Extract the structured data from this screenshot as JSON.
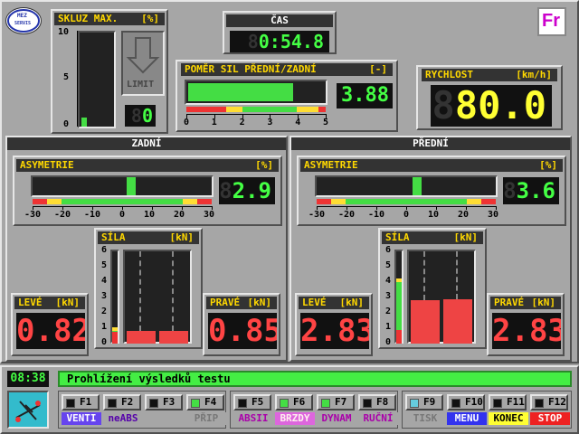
{
  "logo": {
    "top": "MEZ",
    "bottom": "SERVIS"
  },
  "fr_logo": "Fr",
  "skluz": {
    "title": "SKLUZ MAX.",
    "unit": "[%]",
    "ticks": [
      "10",
      "5",
      "0"
    ],
    "value_level": 1.0,
    "limit_label": "LIMIT",
    "digits": "8",
    "value": "0"
  },
  "cas": {
    "title": "ČAS",
    "ghost": "8",
    "value": "0:54.8"
  },
  "pomer": {
    "title": "POMĚR SIL PŘEDNÍ/ZADNÍ",
    "unit": "[-]",
    "ticks": [
      "0",
      "1",
      "2",
      "3",
      "4",
      "5"
    ],
    "ghost": "",
    "value": "3.88",
    "fill_fraction": 0.776
  },
  "rychlost": {
    "title": "RYCHLOST",
    "unit": "[km/h]",
    "ghost": "8",
    "value": "80.0"
  },
  "zadni": {
    "title": "ZADNÍ",
    "asym": {
      "title": "ASYMETRIE",
      "unit": "[%]",
      "ghost": "8",
      "value": "2.9",
      "ticks": [
        "-30",
        "-20",
        "-10",
        "0",
        "10",
        "20",
        "30"
      ],
      "marker_value": 2.9
    },
    "sila": {
      "title": "SÍLA",
      "unit": "[kN]",
      "ticks": [
        "6",
        "5",
        "4",
        "3",
        "2",
        "1",
        "0"
      ],
      "left_value": 0.82,
      "right_value": 0.85,
      "side_level": 0.82
    },
    "leve": {
      "title": "LEVÉ",
      "unit": "[kN]",
      "ghost": "",
      "value": "0.82"
    },
    "prave": {
      "title": "PRAVÉ",
      "unit": "[kN]",
      "ghost": "",
      "value": "0.85"
    }
  },
  "predni": {
    "title": "PŘEDNÍ",
    "asym": {
      "title": "ASYMETRIE",
      "unit": "[%]",
      "ghost": "8",
      "value": "3.6",
      "ticks": [
        "-30",
        "-20",
        "-10",
        "0",
        "10",
        "20",
        "30"
      ],
      "marker_value": 3.6
    },
    "sila": {
      "title": "SÍLA",
      "unit": "[kN]",
      "ticks": [
        "6",
        "5",
        "4",
        "3",
        "2",
        "1",
        "0"
      ],
      "left_value": 2.83,
      "right_value": 2.88,
      "side_level": 4.0
    },
    "leve": {
      "title": "LEVÉ",
      "unit": "[kN]",
      "ghost": "",
      "value": "2.83"
    },
    "prave": {
      "title": "PRAVÉ",
      "unit": "[kN]",
      "ghost": "",
      "value": "2.83"
    }
  },
  "clock": "08:38",
  "status": "Prohlížení výsledků testu",
  "fkeys": [
    {
      "key": "F1",
      "label": "VENTI",
      "bg": "#6644ee",
      "fg": "#ffffff",
      "led": "#111"
    },
    {
      "key": "F2",
      "label": "neABS",
      "bg": "#a6a6a6",
      "fg": "#5500aa",
      "led": "#111"
    },
    {
      "key": "F3",
      "label": "",
      "bg": "#a6a6a6",
      "fg": "#000",
      "led": "#111"
    },
    {
      "key": "F4",
      "label": "PŘIP",
      "bg": "#a6a6a6",
      "fg": "#777",
      "led": "#44dd44"
    },
    {
      "key": "F5",
      "label": "ABSII",
      "bg": "#a6a6a6",
      "fg": "#aa00aa",
      "led": "#111"
    },
    {
      "key": "F6",
      "label": "BRZDY",
      "bg": "#dd66dd",
      "fg": "#ffeeee",
      "led": "#44dd44"
    },
    {
      "key": "F7",
      "label": "DYNAM",
      "bg": "#a6a6a6",
      "fg": "#aa00aa",
      "led": "#44dd44"
    },
    {
      "key": "F8",
      "label": "RUČNÍ",
      "bg": "#a6a6a6",
      "fg": "#aa00aa",
      "led": "#111"
    },
    {
      "key": "F9",
      "label": "TISK",
      "bg": "#a6a6a6",
      "fg": "#777",
      "led": "#66ccdd"
    },
    {
      "key": "F10",
      "label": "MENU",
      "bg": "#3333ee",
      "fg": "#ffffff",
      "led": "#111"
    },
    {
      "key": "F11",
      "label": "KONEC",
      "bg": "#ffff33",
      "fg": "#000000",
      "led": "#111"
    },
    {
      "key": "F12",
      "label": "STOP",
      "bg": "#ee2222",
      "fg": "#ffffff",
      "led": "#111"
    }
  ]
}
